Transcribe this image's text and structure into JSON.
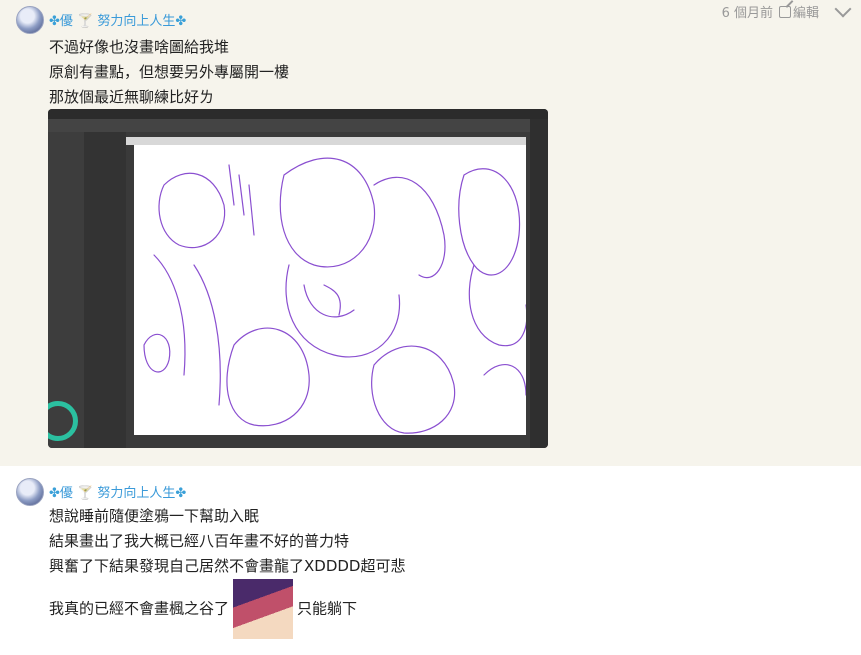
{
  "posts": [
    {
      "author": {
        "prefix": "✤",
        "name": "優",
        "pin": "🍸",
        "tagline": "努力向上人生",
        "suffix": "✤"
      },
      "time": "6 個月前",
      "edit_label": "編輯",
      "lines": [
        "不過好像也沒畫啥圖給我堆",
        "原創有畫點，但想要另外專屬開一樓",
        "那放個最近無聊練比好ㄌ"
      ],
      "attachment": {
        "icon": "drawing-screenshot"
      }
    },
    {
      "author": {
        "prefix": "✤",
        "name": "優",
        "pin": "🍸",
        "tagline": "努力向上人生",
        "suffix": "✤"
      },
      "lines": [
        "想說睡前隨便塗鴉一下幫助入眠",
        "結果畫出了我大概已經八百年畫不好的普力特",
        "興奮了下結果發現自己居然不會畫龍了XDDDD超可悲"
      ],
      "last_line_before": "我真的已經不會畫楓之谷了",
      "last_line_after": "只能躺下",
      "emote": {
        "icon": "sticker-emote"
      }
    }
  ],
  "colors": {
    "link": "#3a9ad9",
    "post_bg": "#f6f4ec",
    "sketch": "#8a4fd0"
  }
}
